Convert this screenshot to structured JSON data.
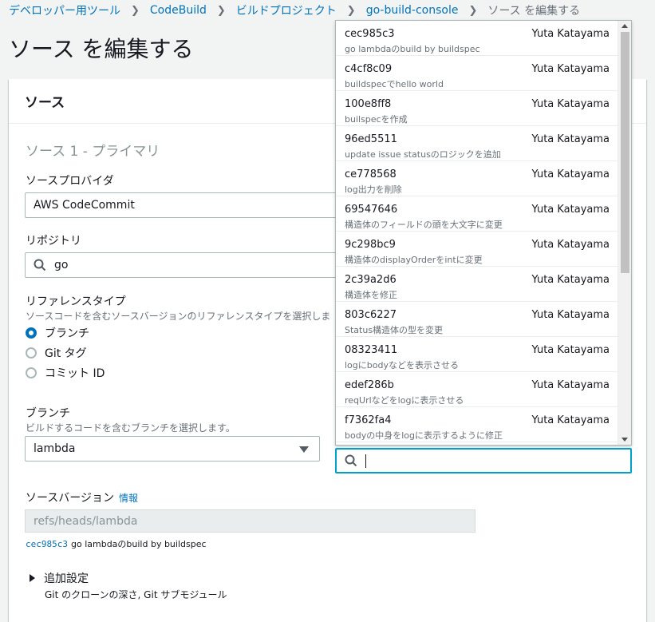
{
  "breadcrumb": {
    "items": [
      "デベロッパー用ツール",
      "CodeBuild",
      "ビルドプロジェクト",
      "go-build-console"
    ],
    "current": "ソース を編集する"
  },
  "page": {
    "title": "ソース を編集する"
  },
  "card": {
    "title": "ソース",
    "section_title": "ソース 1 - プライマリ"
  },
  "form": {
    "source_provider": {
      "label": "ソースプロバイダ",
      "value": "AWS CodeCommit"
    },
    "repository": {
      "label": "リポジトリ",
      "value": "go"
    },
    "reference_type": {
      "label": "リファレンスタイプ",
      "description": "ソースコードを含むソースバージョンのリファレンスタイプを選択しま",
      "options": [
        "ブランチ",
        "Git タグ",
        "コミット ID"
      ],
      "selected": "ブランチ"
    },
    "branch": {
      "label": "ブランチ",
      "description": "ビルドするコードを含むブランチを選択します。",
      "value": "lambda"
    },
    "source_version": {
      "label": "ソースバージョン",
      "info": "情報",
      "value": "refs/heads/lambda",
      "commit_id": "cec985c3",
      "commit_message": "go lambdaのbuild by buildspec"
    },
    "additional": {
      "label": "追加設定",
      "description": "Git のクローンの深さ, Git サブモジュール"
    }
  },
  "dropdown": {
    "items": [
      {
        "id": "cec985c3",
        "author": "Yuta Katayama",
        "message": "go lambdaのbuild by buildspec"
      },
      {
        "id": "c4cf8c09",
        "author": "Yuta Katayama",
        "message": "buildspecでhello world"
      },
      {
        "id": "100e8ff8",
        "author": "Yuta Katayama",
        "message": "builspecを作成"
      },
      {
        "id": "96ed5511",
        "author": "Yuta Katayama",
        "message": "update issue statusのロジックを追加"
      },
      {
        "id": "ce778568",
        "author": "Yuta Katayama",
        "message": "log出力を削除"
      },
      {
        "id": "69547646",
        "author": "Yuta Katayama",
        "message": "構造体のフィールドの頭を大文字に変更"
      },
      {
        "id": "9c298bc9",
        "author": "Yuta Katayama",
        "message": "構造体のdisplayOrderをintに変更"
      },
      {
        "id": "2c39a2d6",
        "author": "Yuta Katayama",
        "message": "構造体を修正"
      },
      {
        "id": "803c6227",
        "author": "Yuta Katayama",
        "message": "Status構造体の型を変更"
      },
      {
        "id": "08323411",
        "author": "Yuta Katayama",
        "message": "logにbodyなどを表示させる"
      },
      {
        "id": "edef286b",
        "author": "Yuta Katayama",
        "message": "reqUrlなどをlogに表示させる"
      },
      {
        "id": "f7362fa4",
        "author": "Yuta Katayama",
        "message": "bodyの中身をlogに表示するように修正"
      }
    ],
    "search_value": ""
  },
  "icons": {
    "search": "search-icon",
    "caret": "caret-down-icon",
    "expand": "expand-triangle-icon"
  },
  "colors": {
    "link": "#0073bb",
    "focus": "#00a1c9",
    "radio_selected": "#0073bb"
  }
}
